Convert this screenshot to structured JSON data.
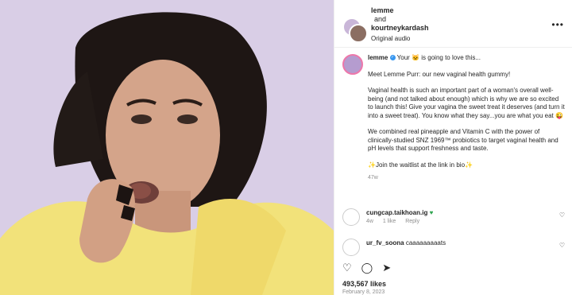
{
  "header": {
    "user1": "lemme",
    "and": "and",
    "user2": "kourtneykardash",
    "audio": "Original audio",
    "more_icon": "more-horizontal-icon"
  },
  "caption": {
    "user": "lemme",
    "intro_a": "Your",
    "intro_b": "is going to love this...",
    "p1": "Meet Lemme Purr: our new vaginal health gummy!",
    "p2": "Vaginal health is such an important part of a woman's overall well-being (and not talked about enough) which is why we are so excited to launch this! Give your vagina the sweet treat it deserves (and turn it into a sweet treat). You know what they say...you are what you eat 😜",
    "p3": "We combined real pineapple and Vitamin C with the power of clinically-studied SNZ 1969™ probiotics to target vaginal health and pH levels that support freshness and taste.",
    "p4": "✨Join the waitlist at the link in bio✨",
    "time": "47w"
  },
  "comments": [
    {
      "user": "cungcap.taikhoan.ig",
      "time": "4w",
      "likes": "1 like",
      "reply": "Reply"
    },
    {
      "user": "ur_fv_soona",
      "text": "caaaaaaaaats"
    }
  ],
  "footer": {
    "likes": "493,567 likes",
    "date": "February 8, 2023"
  },
  "colors": {
    "media_bg": "#d7cbe4",
    "accent": "#3897f0"
  }
}
